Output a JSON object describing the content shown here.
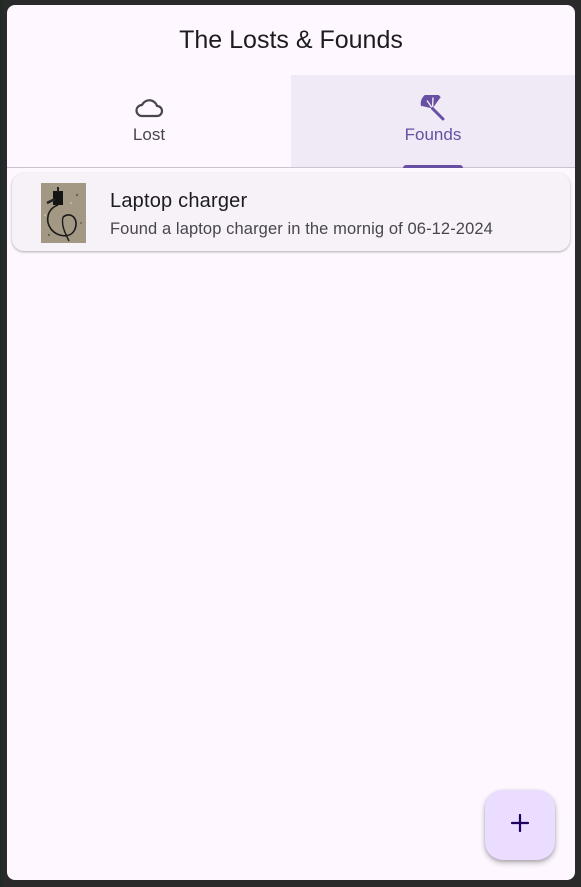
{
  "app": {
    "title": "The Losts & Founds"
  },
  "tabs": [
    {
      "label": "Lost",
      "icon": "cloud-icon",
      "active": false
    },
    {
      "label": "Founds",
      "icon": "umbrella-icon",
      "active": true
    }
  ],
  "items": [
    {
      "title": "Laptop charger",
      "subtitle": "Found a laptop charger in the mornig of 06-12-2024",
      "image": "laptop-charger-photo"
    }
  ],
  "fab": {
    "icon": "plus-icon"
  },
  "colors": {
    "background": "#fef7ff",
    "accent": "#6750a4",
    "active_tab_bg": "#f0e9f6",
    "card_bg": "#f6f2f7",
    "fab_bg": "#eaddff"
  }
}
